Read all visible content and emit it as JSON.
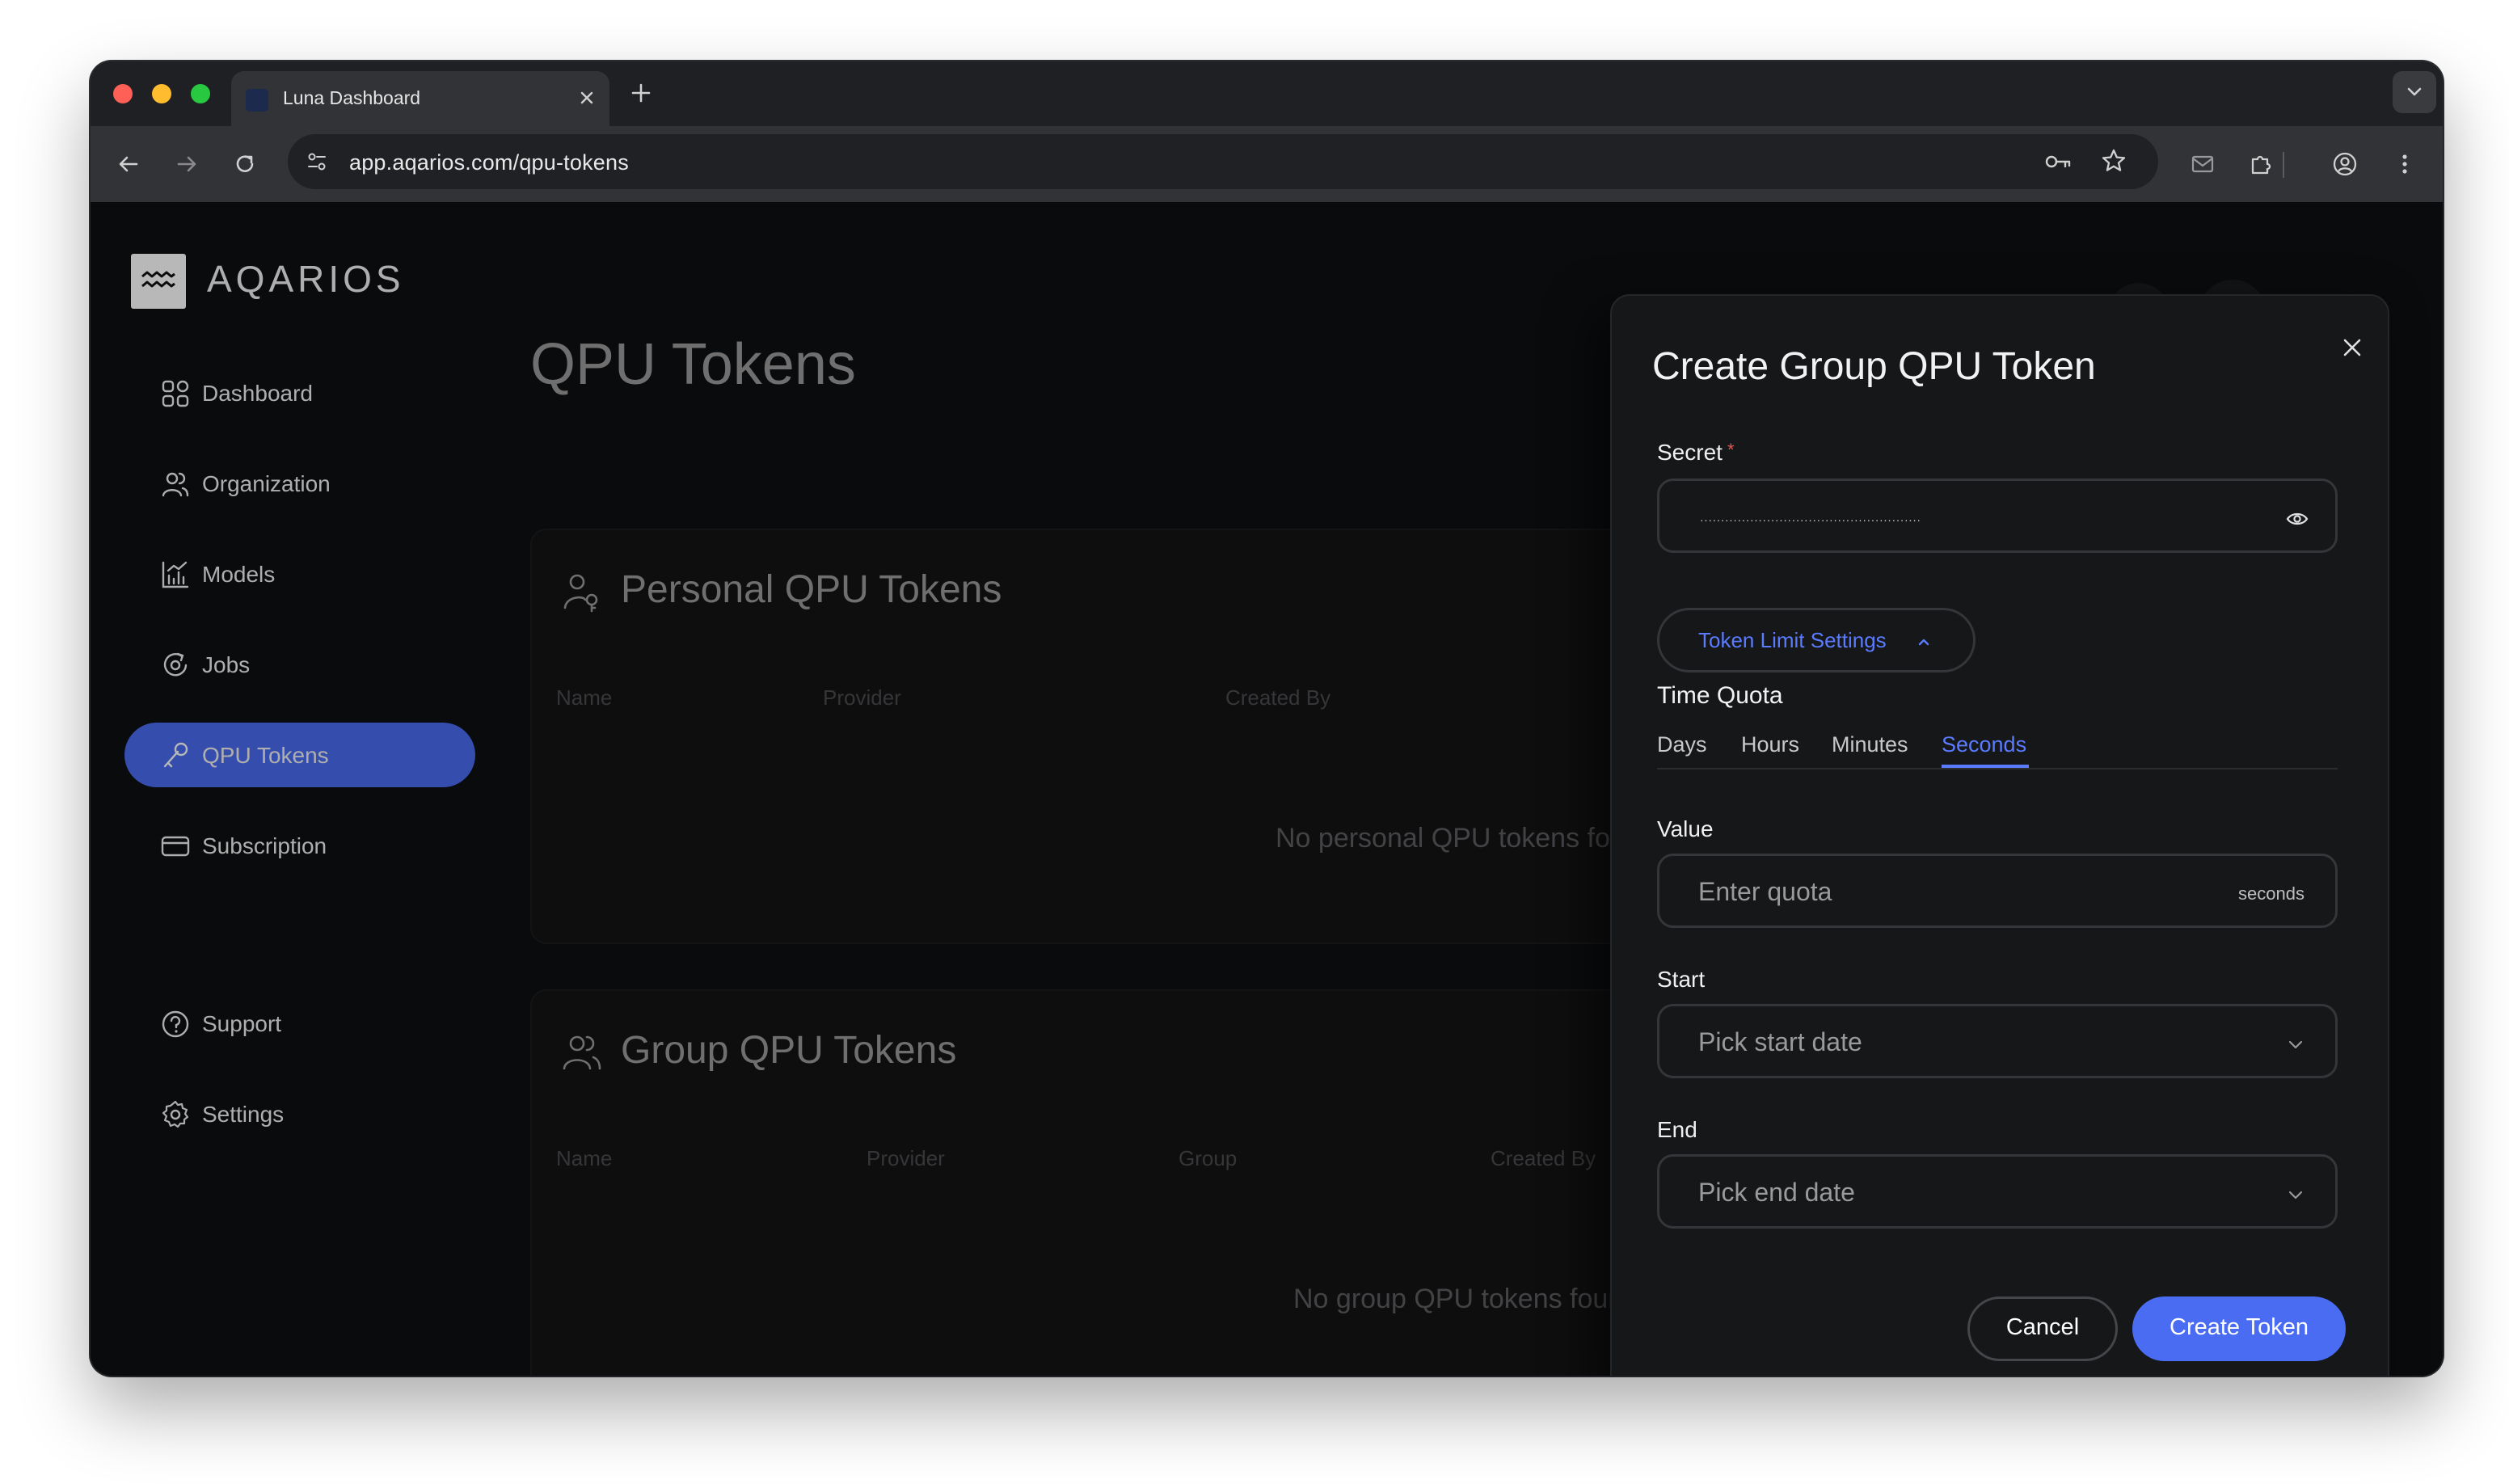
{
  "browser": {
    "tab_title": "Luna Dashboard",
    "url": "app.aqarios.com/qpu-tokens"
  },
  "brand": {
    "logo_text": "AQARIOS"
  },
  "sidebar": {
    "items": [
      {
        "label": "Dashboard",
        "icon": "grid-icon"
      },
      {
        "label": "Organization",
        "icon": "users-icon"
      },
      {
        "label": "Models",
        "icon": "chart-icon"
      },
      {
        "label": "Jobs",
        "icon": "jobs-icon"
      },
      {
        "label": "QPU Tokens",
        "icon": "token-icon",
        "active": true
      },
      {
        "label": "Subscription",
        "icon": "card-icon"
      }
    ],
    "bottom_items": [
      {
        "label": "Support",
        "icon": "help-icon"
      },
      {
        "label": "Settings",
        "icon": "gear-icon"
      }
    ]
  },
  "page": {
    "title": "QPU Tokens",
    "personal": {
      "title": "Personal QPU Tokens",
      "columns": [
        "Name",
        "Provider",
        "Created By"
      ],
      "empty_text": "No personal QPU tokens fou"
    },
    "group": {
      "title": "Group QPU Tokens",
      "columns": [
        "Name",
        "Provider",
        "Group",
        "Created By"
      ],
      "empty_text": "No group QPU tokens foun"
    }
  },
  "dialog": {
    "title": "Create Group QPU Token",
    "secret_label": "Secret",
    "required_mark": "*",
    "secret_value": "·····················································",
    "limit_button": "Token Limit Settings",
    "time_quota_label": "Time Quota",
    "quota_tabs": [
      "Days",
      "Hours",
      "Minutes",
      "Seconds"
    ],
    "active_quota_tab": "Seconds",
    "value_label": "Value",
    "value_placeholder": "Enter quota",
    "value_unit": "seconds",
    "start_label": "Start",
    "start_placeholder": "Pick start date",
    "end_label": "End",
    "end_placeholder": "Pick end date",
    "cancel_label": "Cancel",
    "create_label": "Create Token"
  },
  "colors": {
    "accent": "#4a6cf2",
    "accent_text": "#5b7bff",
    "background": "#0f1012",
    "required": "#e25555"
  }
}
